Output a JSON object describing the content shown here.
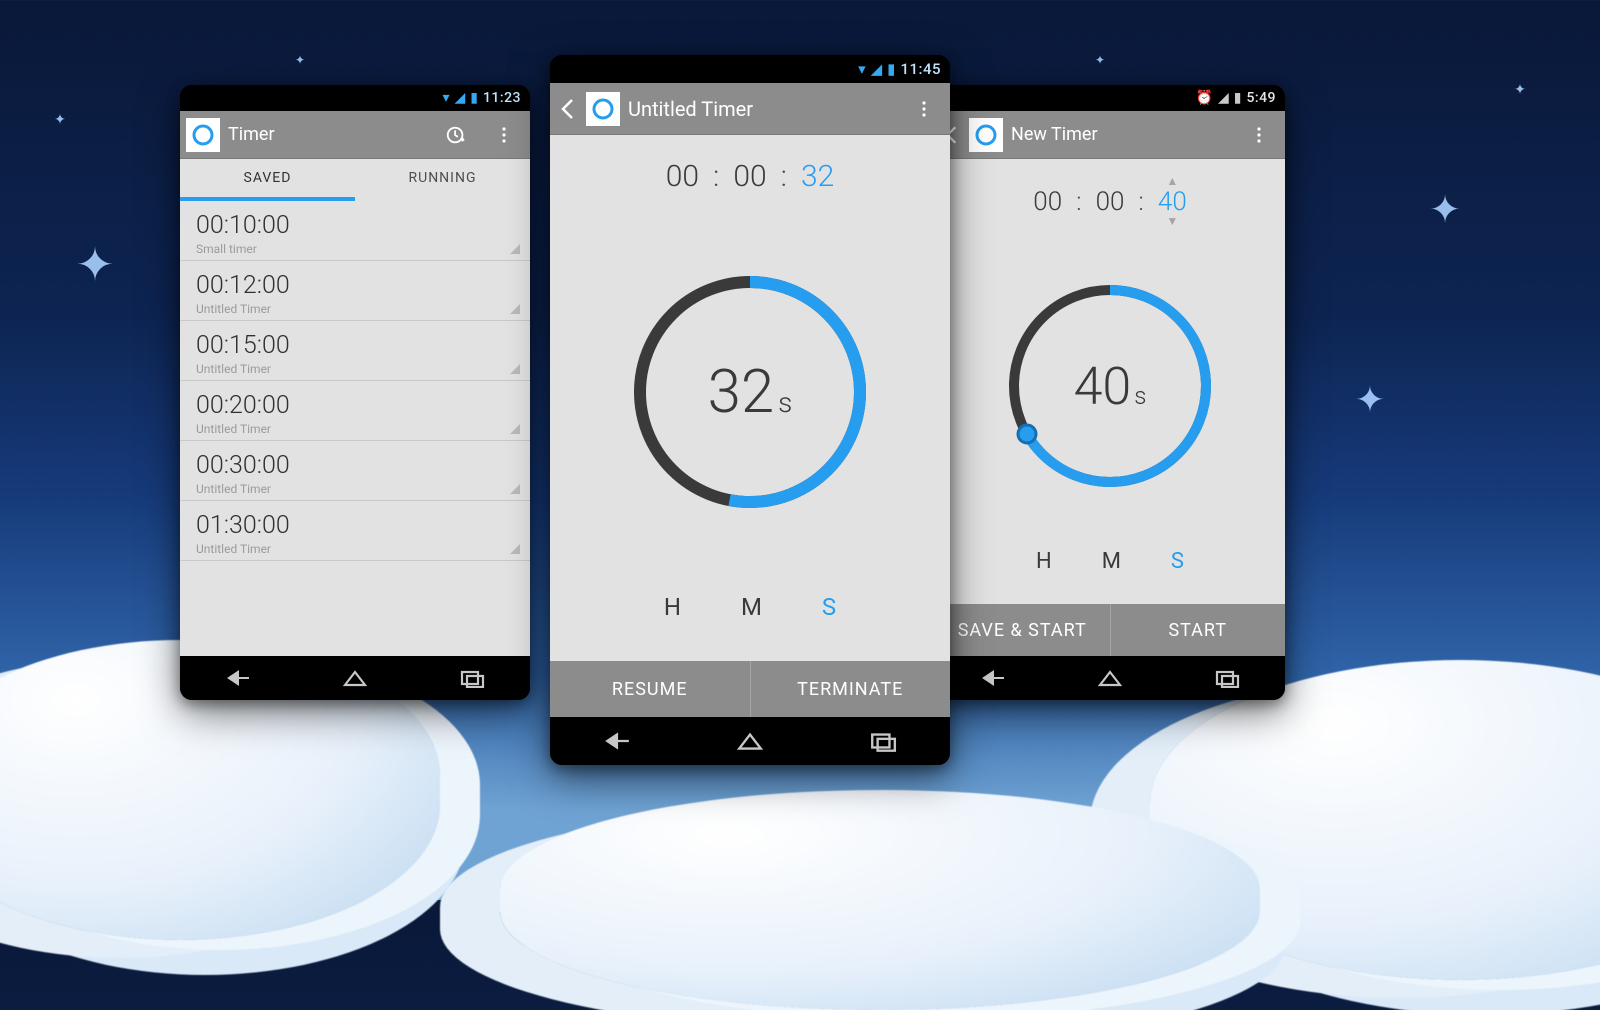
{
  "colors": {
    "accent": "#279df0",
    "appbar": "#8c8c8c",
    "bg": "#e2e2e2",
    "dark": "#3a3a3a"
  },
  "left": {
    "statusbar_time": "11:23",
    "title": "Timer",
    "tabs": [
      {
        "label": "SAVED",
        "active": true
      },
      {
        "label": "RUNNING",
        "active": false
      }
    ],
    "timers": [
      {
        "time": "00:10:00",
        "name": "Small timer"
      },
      {
        "time": "00:12:00",
        "name": "Untitled Timer"
      },
      {
        "time": "00:15:00",
        "name": "Untitled Timer"
      },
      {
        "time": "00:20:00",
        "name": "Untitled Timer"
      },
      {
        "time": "00:30:00",
        "name": "Untitled Timer"
      },
      {
        "time": "01:30:00",
        "name": "Untitled Timer"
      }
    ]
  },
  "center": {
    "statusbar_time": "11:45",
    "title": "Untitled Timer",
    "digits": {
      "h": "00",
      "m": "00",
      "s": "32"
    },
    "remaining": {
      "value": "32",
      "unit": "s",
      "fraction": 0.53
    },
    "hms_labels": {
      "h": "H",
      "m": "M",
      "s": "S",
      "active": "s"
    },
    "buttons": {
      "resume": "RESUME",
      "terminate": "TERMINATE"
    }
  },
  "right": {
    "statusbar_time": "5:49",
    "title": "New Timer",
    "digits": {
      "h": "00",
      "m": "00",
      "s": "40"
    },
    "remaining": {
      "value": "40",
      "unit": "s",
      "fraction": 0.67
    },
    "hms_labels": {
      "h": "H",
      "m": "M",
      "s": "S",
      "active": "s"
    },
    "buttons": {
      "savestart": "SAVE & START",
      "start": "START"
    }
  }
}
